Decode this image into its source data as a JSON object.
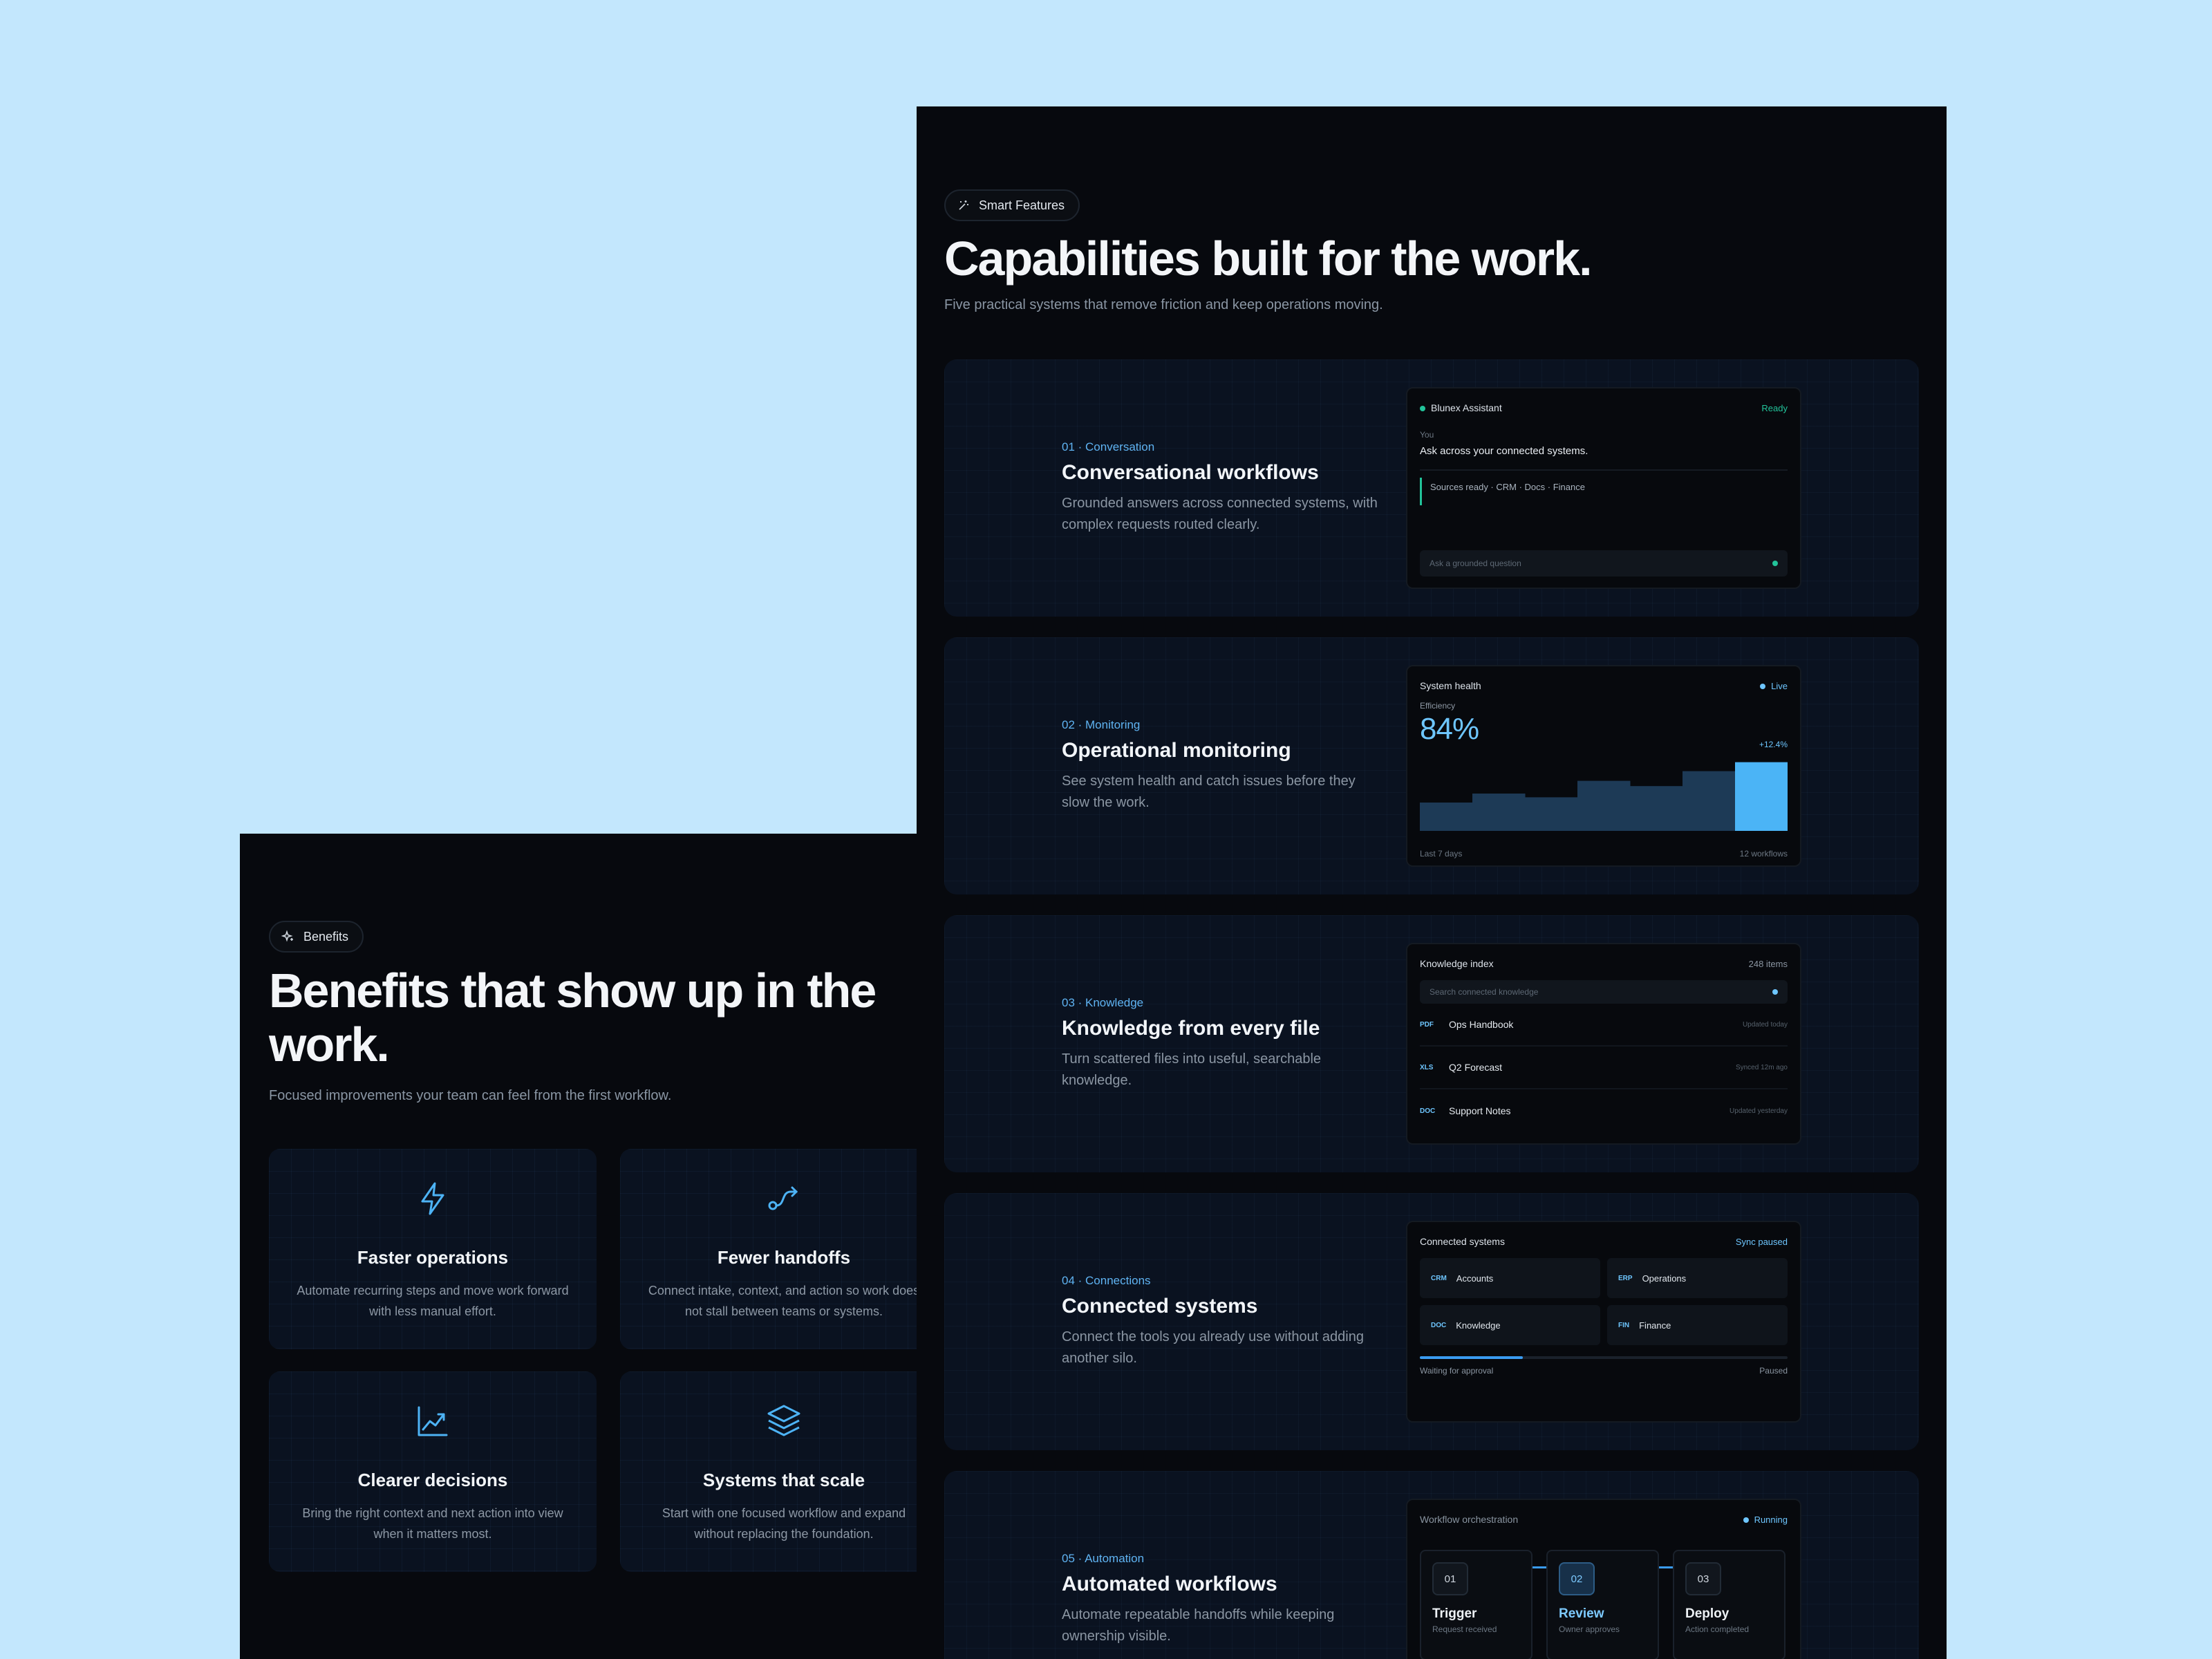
{
  "capabilities": {
    "badge": "Smart Features",
    "title": "Capabilities built for the work.",
    "subtitle": "Five practical systems that remove friction and keep operations moving.",
    "cards": [
      {
        "tag": "01 · Conversation",
        "title": "Conversational workflows",
        "desc": "Grounded answers across connected systems, with complex requests routed clearly.",
        "mock": {
          "name": "Blunex Assistant",
          "status": "Ready",
          "speaker": "You",
          "question": "Ask across your connected systems.",
          "sources": "Sources ready · CRM · Docs · Finance",
          "input_placeholder": "Ask a grounded question"
        }
      },
      {
        "tag": "02 · Monitoring",
        "title": "Operational monitoring",
        "desc": "See system health and catch issues before they slow the work.",
        "mock": {
          "name": "System health",
          "status": "Live",
          "metric_label": "Efficiency",
          "metric_value": "84%",
          "delta": "+12.4%",
          "bar_levels": [
            0.38,
            0.5,
            0.45,
            0.67,
            0.6,
            0.8,
            0.92
          ],
          "foot_left": "Last 7 days",
          "foot_right": "12 workflows"
        }
      },
      {
        "tag": "03 · Knowledge",
        "title": "Knowledge from every file",
        "desc": "Turn scattered files into useful, searchable knowledge.",
        "mock": {
          "name": "Knowledge index",
          "count": "248 items",
          "search_placeholder": "Search connected knowledge",
          "files": [
            {
              "type": "PDF",
              "name": "Ops Handbook",
              "meta": "Updated today"
            },
            {
              "type": "XLS",
              "name": "Q2 Forecast",
              "meta": "Synced 12m ago"
            },
            {
              "type": "DOC",
              "name": "Support Notes",
              "meta": "Updated yesterday"
            }
          ]
        }
      },
      {
        "tag": "04 · Connections",
        "title": "Connected systems",
        "desc": "Connect the tools you already use without adding another silo.",
        "mock": {
          "name": "Connected systems",
          "status": "Sync paused",
          "systems": [
            {
              "code": "CRM",
              "name": "Accounts"
            },
            {
              "code": "ERP",
              "name": "Operations"
            },
            {
              "code": "DOC",
              "name": "Knowledge"
            },
            {
              "code": "FIN",
              "name": "Finance"
            }
          ],
          "progress": 0.28,
          "foot_left": "Waiting for approval",
          "foot_right": "Paused"
        }
      },
      {
        "tag": "05 · Automation",
        "title": "Automated workflows",
        "desc": "Automate repeatable handoffs while keeping ownership visible.",
        "mock": {
          "name": "Workflow orchestration",
          "status": "Running",
          "steps": [
            {
              "num": "01",
              "name": "Trigger",
              "sub": "Request received"
            },
            {
              "num": "02",
              "name": "Review",
              "sub": "Owner approves"
            },
            {
              "num": "03",
              "name": "Deploy",
              "sub": "Action completed"
            }
          ]
        }
      }
    ]
  },
  "benefits": {
    "badge": "Benefits",
    "title": "Benefits that show up in the work.",
    "subtitle": "Focused improvements your team can feel from the first workflow.",
    "cards": [
      {
        "icon": "lightning-icon",
        "title": "Faster operations",
        "desc": "Automate recurring steps and move work forward with less manual effort."
      },
      {
        "icon": "route-icon",
        "title": "Fewer handoffs",
        "desc": "Connect intake, context, and action so work does not stall between teams or systems."
      },
      {
        "icon": "trending-chart-icon",
        "title": "Clearer decisions",
        "desc": "Bring the right context and next action into view when it matters most."
      },
      {
        "icon": "layers-icon",
        "title": "Systems that scale",
        "desc": "Start with one focused workflow and expand without replacing the foundation."
      }
    ]
  },
  "colors": {
    "page_bg": "#c3e7fd",
    "panel_bg": "#07090e",
    "accent": "#6ec6ff",
    "ready_green": "#22c39a"
  }
}
